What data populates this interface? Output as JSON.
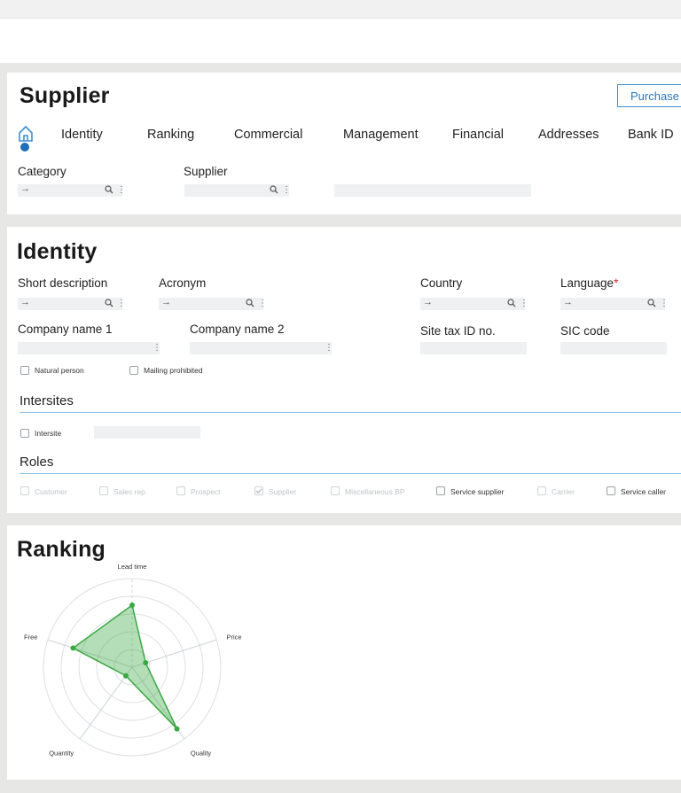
{
  "header": {
    "title": "Supplier",
    "purchase_button": "Purchase",
    "tabs": [
      "Identity",
      "Ranking",
      "Commercial",
      "Management",
      "Financial",
      "Addresses",
      "Bank ID"
    ],
    "fields": {
      "category_label": "Category",
      "supplier_label": "Supplier",
      "arrow": "→"
    }
  },
  "identity": {
    "title": "Identity",
    "short_description": "Short description",
    "acronym": "Acronym",
    "country": "Country",
    "language": "Language",
    "required_marker": "*",
    "company_name_1": "Company name 1",
    "company_name_2": "Company name 2",
    "site_tax_id": "Site tax ID no.",
    "sic_code": "SIC code",
    "natural_person": "Natural person",
    "mailing_prohibited": "Mailing prohibited",
    "intersites_title": "Intersites",
    "intersite": "Intersite",
    "roles_title": "Roles",
    "roles": [
      {
        "label": "Customer",
        "checked": false,
        "enabled": false
      },
      {
        "label": "Sales rep",
        "checked": false,
        "enabled": false
      },
      {
        "label": "Prospect",
        "checked": false,
        "enabled": false
      },
      {
        "label": "Supplier",
        "checked": true,
        "enabled": false
      },
      {
        "label": "Miscellaneous BP",
        "checked": false,
        "enabled": false
      },
      {
        "label": "Service supplier",
        "checked": false,
        "enabled": true
      },
      {
        "label": "Carrier",
        "checked": false,
        "enabled": false
      },
      {
        "label": "Service caller",
        "checked": false,
        "enabled": true
      }
    ]
  },
  "ranking": {
    "title": "Ranking",
    "accent_color": "#3aa843",
    "chart_data": {
      "type": "radar",
      "axes": [
        "Lead time",
        "Price",
        "Quality",
        "Quantity",
        "Free"
      ],
      "max": 5,
      "values": [
        3.5,
        0.8,
        4.3,
        0.6,
        3.5
      ]
    }
  }
}
